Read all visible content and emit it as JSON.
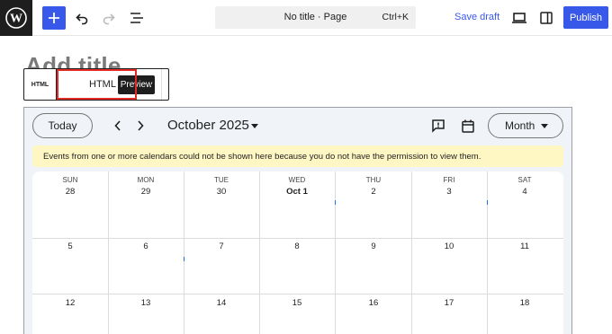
{
  "topbar": {
    "document_title": "No title · Page",
    "shortcut": "Ctrl+K",
    "save_draft": "Save draft",
    "publish": "Publish"
  },
  "editor": {
    "title_placeholder": "Add title"
  },
  "block_toolbar": {
    "block_icon_label": "HTML",
    "tab_html": "HTML",
    "tab_preview": "Preview"
  },
  "calendar": {
    "today_button": "Today",
    "month_year": "October 2025",
    "view_button": "Month",
    "banner": "Events from one or more calendars could not be shown here because you do not have the permission to view them.",
    "weekdays": [
      "SUN",
      "MON",
      "TUE",
      "WED",
      "THU",
      "FRI",
      "SAT"
    ],
    "week1": [
      "28",
      "29",
      "30",
      "Oct 1",
      "2",
      "3",
      "4"
    ],
    "week2": [
      "5",
      "6",
      "7",
      "8",
      "9",
      "10",
      "11"
    ],
    "week3": [
      "12",
      "13",
      "14",
      "15",
      "16",
      "17",
      "18"
    ]
  },
  "colors": {
    "accent": "#3858e9",
    "highlight": "#e02b27",
    "banner": "#fef7c3",
    "calendar_bg": "#f0f4f9"
  }
}
